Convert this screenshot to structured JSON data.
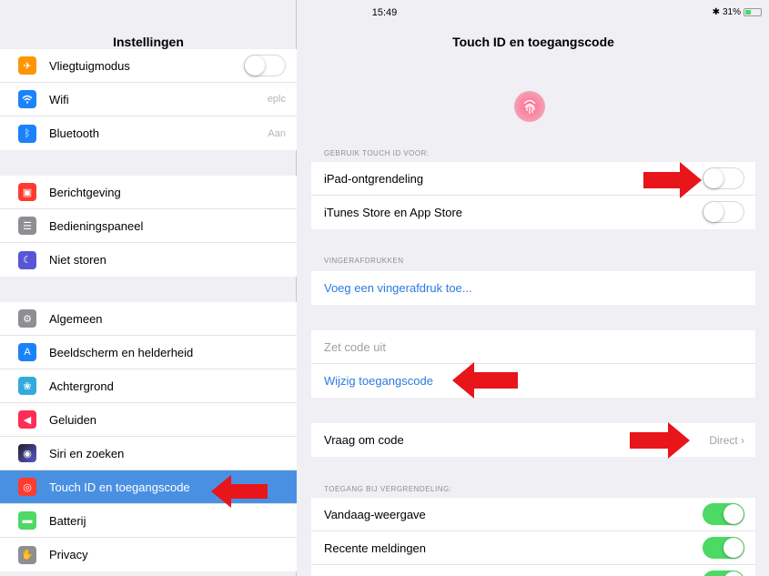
{
  "status": {
    "device": "iPad",
    "time": "15:49",
    "battery": "31%"
  },
  "sidebar": {
    "title": "Instellingen",
    "groups": [
      [
        {
          "label": "Vliegtuigmodus",
          "icon": "airplane-icon",
          "color": "#ff9500",
          "toggle": false
        },
        {
          "label": "Wifi",
          "icon": "wifi-icon",
          "color": "#1a82fb",
          "value": "eplc"
        },
        {
          "label": "Bluetooth",
          "icon": "bluetooth-icon",
          "color": "#1a82fb",
          "value": "Aan"
        }
      ],
      [
        {
          "label": "Berichtgeving",
          "icon": "notifications-icon",
          "color": "#ff3b30"
        },
        {
          "label": "Bedieningspaneel",
          "icon": "control-center-icon",
          "color": "#8e8e93"
        },
        {
          "label": "Niet storen",
          "icon": "moon-icon",
          "color": "#5856d6"
        }
      ],
      [
        {
          "label": "Algemeen",
          "icon": "gear-icon",
          "color": "#8e8e93"
        },
        {
          "label": "Beeldscherm en helderheid",
          "icon": "display-icon",
          "color": "#1a82fb"
        },
        {
          "label": "Achtergrond",
          "icon": "wallpaper-icon",
          "color": "#34aadc"
        },
        {
          "label": "Geluiden",
          "icon": "sound-icon",
          "color": "#ff2d55"
        },
        {
          "label": "Siri en zoeken",
          "icon": "siri-icon",
          "color": "#222"
        },
        {
          "label": "Touch ID en toegangscode",
          "icon": "touchid-icon",
          "color": "#ff3b30",
          "selected": true
        },
        {
          "label": "Batterij",
          "icon": "battery-icon",
          "color": "#4cd964"
        },
        {
          "label": "Privacy",
          "icon": "privacy-icon",
          "color": "#8e8e93"
        }
      ]
    ]
  },
  "main": {
    "title": "Touch ID en toegangscode",
    "section_touchid": "GEBRUIK TOUCH ID VOOR:",
    "ipad_unlock": "iPad-ontgrendeling",
    "itunes": "iTunes Store en App Store",
    "section_fingerprints": "VINGERAFDRUKKEN",
    "add_fingerprint": "Voeg een vingerafdruk toe...",
    "code_off": "Zet code uit",
    "change_code": "Wijzig toegangscode",
    "require_code": "Vraag om code",
    "require_code_value": "Direct",
    "section_access": "TOEGANG BIJ VERGRENDELING:",
    "today_view": "Vandaag-weergave",
    "recent_notifications": "Recente meldingen"
  },
  "colors": {
    "accent": "#2a7ae2",
    "arrow": "#e8151b",
    "toggle_on": "#4cd964",
    "selected": "#4a90e2"
  }
}
